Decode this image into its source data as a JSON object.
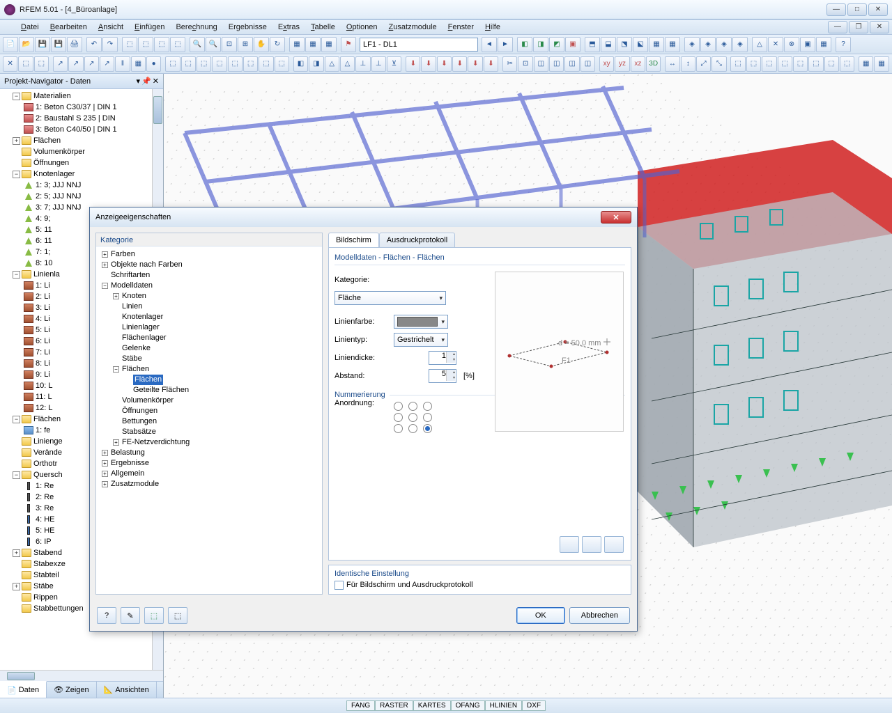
{
  "app": {
    "title": "RFEM 5.01 - [4_Büroanlage]"
  },
  "menus": [
    "Datei",
    "Bearbeiten",
    "Ansicht",
    "Einfügen",
    "Berechnung",
    "Ergebnisse",
    "Extras",
    "Tabelle",
    "Optionen",
    "Zusatzmodule",
    "Fenster",
    "Hilfe"
  ],
  "load_case": "LF1 - DL1",
  "nav": {
    "title": "Projekt-Navigator - Daten",
    "tabs": {
      "data": "Daten",
      "show": "Zeigen",
      "views": "Ansichten"
    },
    "tree": {
      "materialien": "Materialien",
      "mat1": "1: Beton C30/37 | DIN 1",
      "mat2": "2: Baustahl S 235 | DIN",
      "mat3": "3: Beton C40/50 | DIN 1",
      "flaechen": "Flächen",
      "volumen": "Volumenkörper",
      "oeffnungen": "Öffnungen",
      "knotenlager": "Knotenlager",
      "kl1": "1: 3; JJJ NNJ",
      "kl2": "2: 5; JJJ NNJ",
      "kl3": "3: 7; JJJ NNJ",
      "kl4": "4: 9;",
      "kl5": "5: 11",
      "kl6": "6: 11",
      "kl7": "7: 1;",
      "kl8": "8: 10",
      "linienla": "Linienla",
      "ll1": "1: Li",
      "ll2": "2: Li",
      "ll3": "3: Li",
      "ll4": "4: Li",
      "ll5": "5: Li",
      "ll6": "6: Li",
      "ll7": "7: Li",
      "ll8": "8: Li",
      "ll9": "9: Li",
      "ll10": "10: L",
      "ll11": "11: L",
      "ll12": "12: L",
      "flaechen2": "Flächen",
      "fe1": "1: fe",
      "linienge": "Linienge",
      "veraende": "Verände",
      "orthotr": "Orthotr",
      "quersch": "Quersch",
      "q1": "1: Re",
      "q2": "2: Re",
      "q3": "3: Re",
      "q4": "4: HE",
      "q5": "5: HE",
      "q6": "6: IP",
      "stabend": "Stabend",
      "stabexze": "Stabexze",
      "stabteil": "Stabteil",
      "staebe": "Stäbe",
      "rippen": "Rippen",
      "stabbett": "Stabbettungen"
    }
  },
  "dialog": {
    "title": "Anzeigeeigenschaften",
    "cat_header": "Kategorie",
    "cats": {
      "farben": "Farben",
      "obj_farben": "Objekte nach Farben",
      "schrift": "Schriftarten",
      "modell": "Modelldaten",
      "knoten": "Knoten",
      "linien": "Linien",
      "knotenlager": "Knotenlager",
      "linienlager": "Linienlager",
      "flaechenlager": "Flächenlager",
      "gelenke": "Gelenke",
      "staebe": "Stäbe",
      "flaechen": "Flächen",
      "flaechen_sel": "Flächen",
      "geteilte": "Geteilte Flächen",
      "volumen": "Volumenkörper",
      "oeffnungen": "Öffnungen",
      "bettungen": "Bettungen",
      "stabsaetze": "Stabsätze",
      "fenetz": "FE-Netzverdichtung",
      "belastung": "Belastung",
      "ergebnisse": "Ergebnisse",
      "allgemein": "Allgemein",
      "zusatz": "Zusatzmodule"
    },
    "tabs": {
      "screen": "Bildschirm",
      "print": "Ausdruckprotokoll"
    },
    "breadcrumb": "Modelldaten - Flächen - Flächen",
    "form": {
      "kat_label": "Kategorie:",
      "kat_value": "Fläche",
      "linienfarbe": "Linienfarbe:",
      "linientyp": "Linientyp:",
      "linientyp_value": "Gestrichelt",
      "liniendicke": "Liniendicke:",
      "liniendicke_value": "1",
      "abstand": "Abstand:",
      "abstand_value": "5",
      "abstand_unit": "[%]",
      "nummerierung": "Nummerierung",
      "anordnung": "Anordnung:"
    },
    "preview": {
      "label": "d = 50.0 mm",
      "f1": "F1"
    },
    "identical": {
      "title": "Identische Einstellung",
      "check": "Für Bildschirm und Ausdruckprotokoll"
    },
    "buttons": {
      "ok": "OK",
      "cancel": "Abbrechen"
    }
  },
  "status": [
    "FANG",
    "RASTER",
    "KARTES",
    "OFANG",
    "HLINIEN",
    "DXF"
  ]
}
